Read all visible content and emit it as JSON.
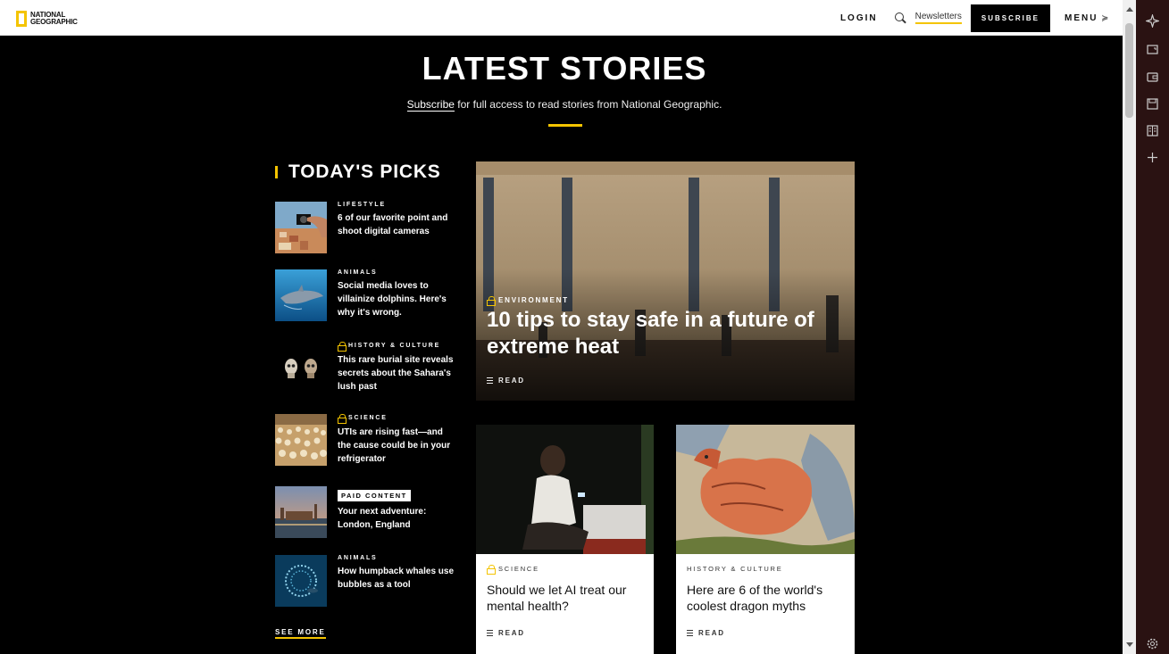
{
  "header": {
    "logo_line1": "NATIONAL",
    "logo_line2": "GEOGRAPHIC",
    "login": "LOGIN",
    "newsletters": "Newsletters",
    "subscribe": "SUBSCRIBE",
    "menu": "MENU"
  },
  "colors": {
    "accent": "#f4c400",
    "background": "#000000",
    "header_bg": "#ffffff",
    "sidebar_bg": "#2a1212"
  },
  "main": {
    "title": "LATEST STORIES",
    "subtitle_link": "Subscribe",
    "subtitle_rest": " for full access to read stories from National Geographic."
  },
  "picks": {
    "title": "TODAY'S PICKS",
    "see_more": "SEE MORE",
    "items": [
      {
        "category": "LIFESTYLE",
        "title": "6 of our favorite point and shoot digital cameras",
        "locked": false
      },
      {
        "category": "ANIMALS",
        "title": "Social media loves to villainize dolphins. Here's why it's wrong.",
        "locked": false
      },
      {
        "category": "HISTORY & CULTURE",
        "title": "This rare burial site reveals secrets about the Sahara's lush past",
        "locked": true
      },
      {
        "category": "SCIENCE",
        "title": "UTIs are rising fast—and the cause could be in your refrigerator",
        "locked": true
      },
      {
        "category": "PAID CONTENT",
        "title": "Your next adventure: London, England",
        "locked": false
      },
      {
        "category": "ANIMALS",
        "title": "How humpback whales use bubbles as a tool",
        "locked": false
      }
    ]
  },
  "feature": {
    "category": "ENVIRONMENT",
    "title": "10 tips to stay safe in a future of extreme heat",
    "read": "READ"
  },
  "cards": [
    {
      "category": "SCIENCE",
      "title": "Should we let AI treat our mental health?",
      "read": "READ",
      "locked": true
    },
    {
      "category": "HISTORY & CULTURE",
      "title": "Here are 6 of the world's coolest dragon myths",
      "read": "READ",
      "locked": false
    }
  ],
  "icons": {
    "sidebar": [
      "copilot-icon",
      "screenshot-icon",
      "wallet-icon",
      "save-icon",
      "reading-icon",
      "add-icon",
      "settings-icon"
    ]
  }
}
